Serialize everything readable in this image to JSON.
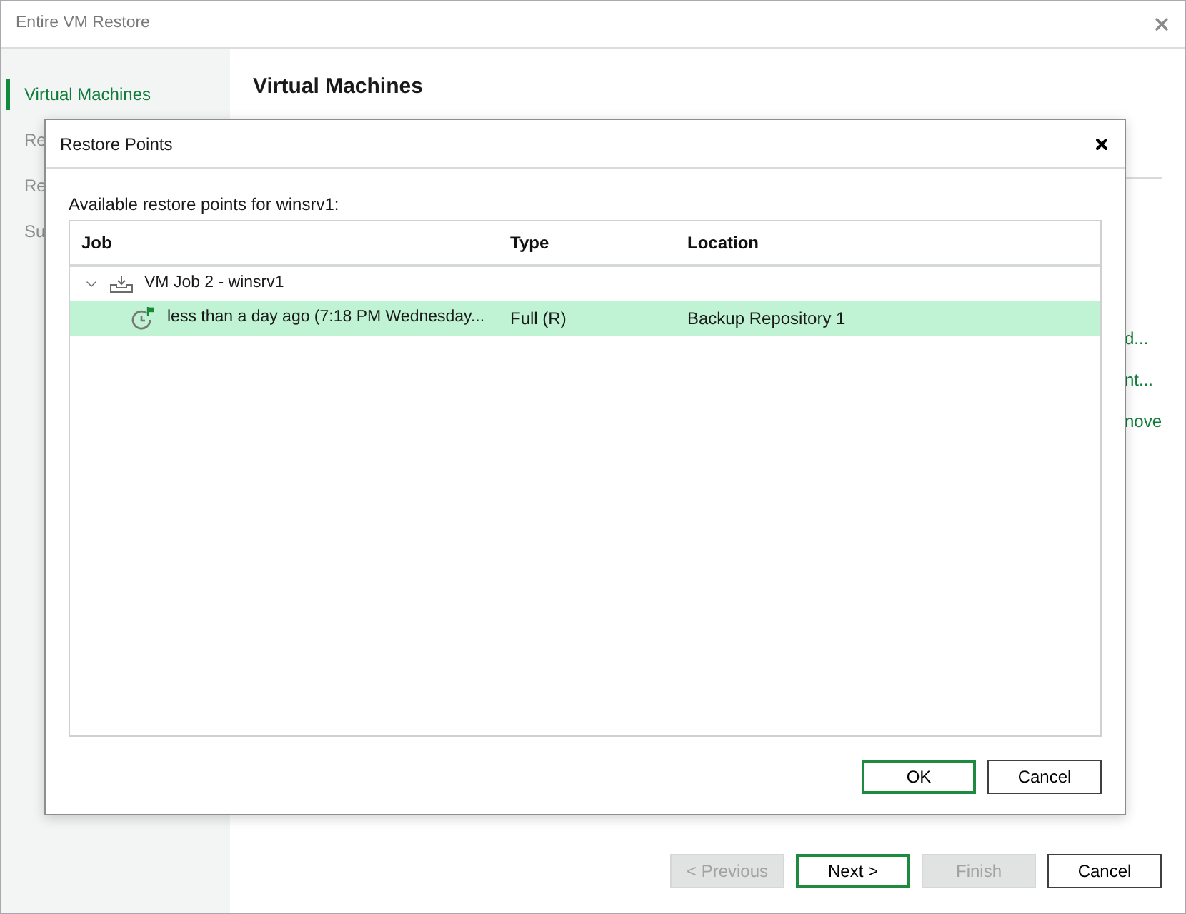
{
  "window": {
    "title": "Entire VM Restore"
  },
  "sidebar": {
    "items": [
      {
        "label": "Virtual Machines",
        "selected": true
      },
      {
        "label": "Re",
        "selected": false
      },
      {
        "label": "Re",
        "selected": false
      },
      {
        "label": "Su",
        "selected": false
      }
    ]
  },
  "main": {
    "heading": "Virtual Machines",
    "links": [
      "d...",
      "nt...",
      "nove"
    ]
  },
  "dialog": {
    "title": "Restore Points",
    "caption": "Available restore points for winsrv1:",
    "table": {
      "columns": [
        "Job",
        "Type",
        "Location"
      ],
      "rows": [
        {
          "kind": "job",
          "cells": [
            "VM Job 2 - winsrv1"
          ],
          "expanded": true,
          "selected": false,
          "children": [
            {
              "kind": "restore_point",
              "cells": [
                "less than a day ago (7:18 PM Wednesday...",
                "Full (R)",
                "Backup Repository 1"
              ],
              "selected": true
            }
          ]
        }
      ]
    },
    "buttons": [
      {
        "label": "OK",
        "default": true
      },
      {
        "label": "Cancel",
        "default": false
      }
    ]
  },
  "footer_buttons": [
    {
      "label": "< Previous",
      "disabled": true,
      "default": false
    },
    {
      "label": "Next >",
      "disabled": false,
      "default": true
    },
    {
      "label": "Finish",
      "disabled": true,
      "default": false
    },
    {
      "label": "Cancel",
      "disabled": false,
      "default": false
    }
  ]
}
